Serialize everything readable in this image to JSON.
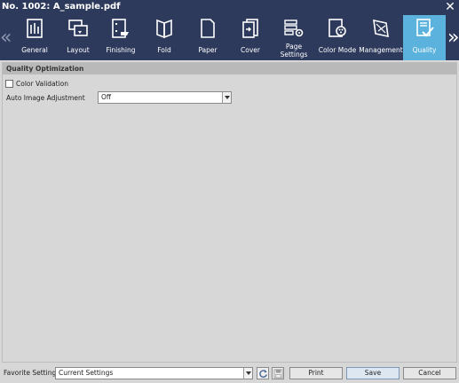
{
  "window": {
    "title": "No. 1002: A_sample.pdf"
  },
  "tabs": [
    {
      "label": "General"
    },
    {
      "label": "Layout"
    },
    {
      "label": "Finishing"
    },
    {
      "label": "Fold"
    },
    {
      "label": "Paper"
    },
    {
      "label": "Cover"
    },
    {
      "label": "Page Settings"
    },
    {
      "label": "Color Mode"
    },
    {
      "label": "Management"
    },
    {
      "label": "Quality",
      "active": true
    }
  ],
  "section": {
    "title": "Quality Optimization"
  },
  "color_validation": {
    "label": "Color Validation",
    "checked": false
  },
  "auto_image_adjustment": {
    "label": "Auto Image Adjustment",
    "value": "Off"
  },
  "footer": {
    "favorite_label": "Favorite Setting",
    "favorite_value": "Current Settings",
    "print_label": "Print",
    "save_label": "Save",
    "cancel_label": "Cancel"
  },
  "colors": {
    "header_bg": "#2d3a5c",
    "active_tab": "#5bb2dd",
    "panel_bg": "#d7d7d7"
  }
}
